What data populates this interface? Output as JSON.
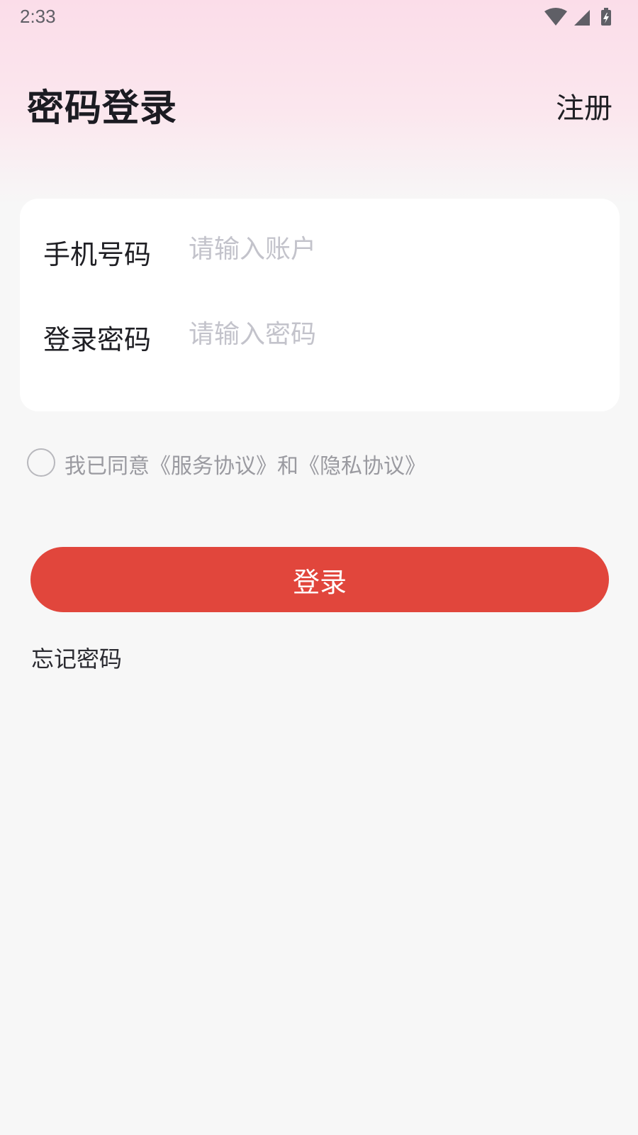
{
  "status_bar": {
    "time": "2:33",
    "icons": [
      "wifi-icon",
      "cellular-signal-icon",
      "battery-charging-icon"
    ]
  },
  "header": {
    "title": "密码登录",
    "register_label": "注册"
  },
  "form": {
    "phone": {
      "label": "手机号码",
      "value": "",
      "placeholder": "请输入账户"
    },
    "password": {
      "label": "登录密码",
      "value": "",
      "placeholder": "请输入密码"
    }
  },
  "agreement": {
    "checked": false,
    "prefix": "我已同意",
    "service_link": "《服务协议》",
    "conjunction": "和",
    "privacy_link": "《隐私协议》"
  },
  "login_button_label": "登录",
  "forgot_password_label": "忘记密码",
  "colors": {
    "primary": "#e1463c",
    "background": "#f7f7f7",
    "header_gradient_top": "#fbdde9",
    "card": "#ffffff",
    "placeholder": "#c3c3cb",
    "muted_text": "#9a9aa0",
    "text": "#1f1f24"
  }
}
